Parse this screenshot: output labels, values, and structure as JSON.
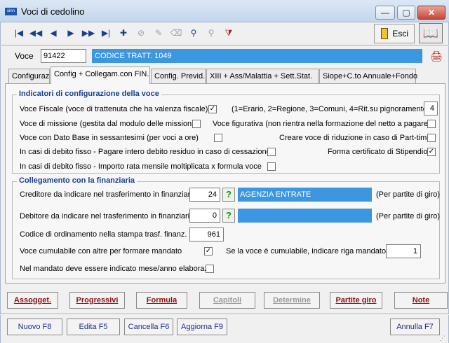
{
  "window": {
    "title": "Voci di cedolino",
    "app_icon_text": "sinn",
    "controls": {
      "minimize": "—",
      "maximize": "▢",
      "close": "✕"
    }
  },
  "toolbar": {
    "icons": [
      "first-record-icon",
      "previous-page-icon",
      "previous-record-icon",
      "next-record-icon",
      "next-page-icon",
      "last-record-icon",
      "add-record-icon",
      "delete-record-icon",
      "edit-record-icon",
      "eraser-icon",
      "search-icon",
      "search-disabled-icon",
      "clear-filter-icon"
    ],
    "glyphs": [
      "|◀",
      "◀◀",
      "◀",
      "▶",
      "▶▶",
      "▶|",
      "✚",
      "⊘",
      "✎",
      "⌫",
      "⚲",
      "⚲",
      "⧩"
    ],
    "exit_label": "Esci",
    "book_glyph": "📖"
  },
  "voce": {
    "label": "Voce",
    "code": "91422",
    "description": "CODICE TRATT. 1049",
    "print_glyph": "🖨"
  },
  "tabs": [
    {
      "label": "Configuraz",
      "active": false
    },
    {
      "label": "Config + Collegam.con FIN.",
      "active": true
    },
    {
      "label": "Config. Previd.",
      "active": false
    },
    {
      "label": "XIII +  Ass/Malattia + Sett.Stat.",
      "active": false
    },
    {
      "label": "Siope+C.to Annuale+Fondo",
      "active": false
    }
  ],
  "indicatori": {
    "title": "Indicatori di configurazione della voce",
    "voce_fiscale": {
      "label": "Voce Fiscale (voce di trattenuta che ha valenza fiscale)",
      "checked": true
    },
    "voce_fiscale_hint": "(1=Erario, 2=Regione, 3=Comuni, 4=Rit.su pignoramento)",
    "voce_fiscale_value": "4",
    "voce_missione": {
      "label": "Voce di missione (gestita dal modulo delle missioni)",
      "checked": false
    },
    "voce_figurativa": {
      "label": "Voce figurativa (non rientra nella formazione del netto a pagare)",
      "checked": false
    },
    "dato_base": {
      "label": "Voce con Dato Base in sessantesimi (per voci a ore)",
      "checked": false
    },
    "riduzione_part_time": {
      "label": "Creare voce di riduzione in caso di Part-time",
      "checked": false
    },
    "debito_intero": {
      "label": "In casi di debito fisso - Pagare intero debito residuo in caso di cessazione",
      "checked": false
    },
    "forma_certificato": {
      "label": "Forma certificato di Stipendio",
      "checked": true
    },
    "debito_rata": {
      "label": "In casi di debito fisso - Importo rata mensile moltiplicata x formula voce",
      "checked": false
    }
  },
  "finanziaria": {
    "title": "Collegamento con la finanziaria",
    "creditore": {
      "label": "Creditore da indicare nel trasferimento in finanziaria",
      "value": "24",
      "name": "AGENZIA ENTRATE",
      "note": "(Per partite di giro)"
    },
    "debitore": {
      "label": "Debitore da indicare nel trasferimento in finanziaria",
      "value": "0",
      "name": "",
      "note": "(Per partite di giro)"
    },
    "codice_ordinamento": {
      "label": "Codice di ordinamento nella  stampa trasf. finanz.",
      "value": "961"
    },
    "cumulabile": {
      "label": "Voce cumulabile con altre per formare mandato",
      "checked": true
    },
    "riga_mandato": {
      "label": "Se la voce è cumulabile, indicare riga mandato",
      "value": "1"
    },
    "mese_anno": {
      "label": "Nel mandato deve essere indicato mese/anno elaboraz",
      "checked": false
    },
    "lookup_glyph": "?"
  },
  "action_buttons": [
    {
      "label": "Assogget.",
      "enabled": true
    },
    {
      "label": "Progressivi",
      "enabled": true
    },
    {
      "label": "Formula",
      "enabled": true
    },
    {
      "label": "Capitoli",
      "enabled": false
    },
    {
      "label": "Determine",
      "enabled": false
    },
    {
      "label": "Partite giro",
      "enabled": true
    },
    {
      "label": "Note",
      "enabled": true
    }
  ],
  "nav_buttons": {
    "nuovo": "Nuovo F8",
    "edita": "Edita F5",
    "cancella": "Cancella F6",
    "aggiorna": "Aggiorna F9",
    "annulla": "Annulla F7"
  },
  "colors": {
    "field_blue": "#3d96e0",
    "group_title": "#1a3f8f",
    "action_text": "#8a1010"
  }
}
